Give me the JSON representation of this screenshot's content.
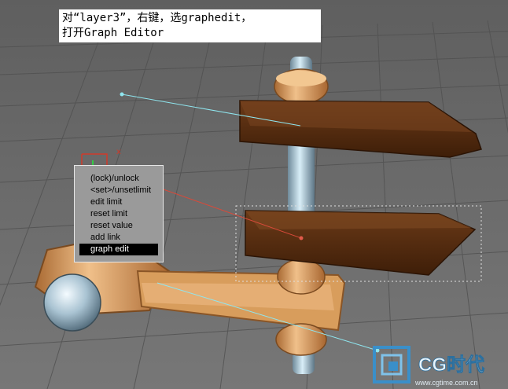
{
  "caption": {
    "line1": "对“layer3”，右键，选graphedit，",
    "line2": "打开Graph Editor"
  },
  "quad_menu": {
    "items": [
      {
        "label": "(lock)/unlock",
        "selected": false
      },
      {
        "label": "<set>/unsetlimit",
        "selected": false
      },
      {
        "label": "edit limit",
        "selected": false
      },
      {
        "label": "reset limit",
        "selected": false
      },
      {
        "label": "reset value",
        "selected": false
      },
      {
        "label": "add link",
        "selected": false
      },
      {
        "label": "graph edit",
        "selected": true
      }
    ]
  },
  "gizmo": {
    "axis_label": "x"
  },
  "watermark": {
    "brand": "CG时代",
    "url": "www.cgtime.com.cn"
  },
  "colors": {
    "viewport_bg": "#6b6b6b",
    "grid_line": "#555555",
    "wood_dark": "#5a2f12",
    "copper": "#d69a5a",
    "link_cyan": "#8fe6ef",
    "link_red": "#d84a3a",
    "menu_bg": "#9a9a9a",
    "menu_selected": "#000000",
    "watermark_blue": "#3a8fc9"
  }
}
